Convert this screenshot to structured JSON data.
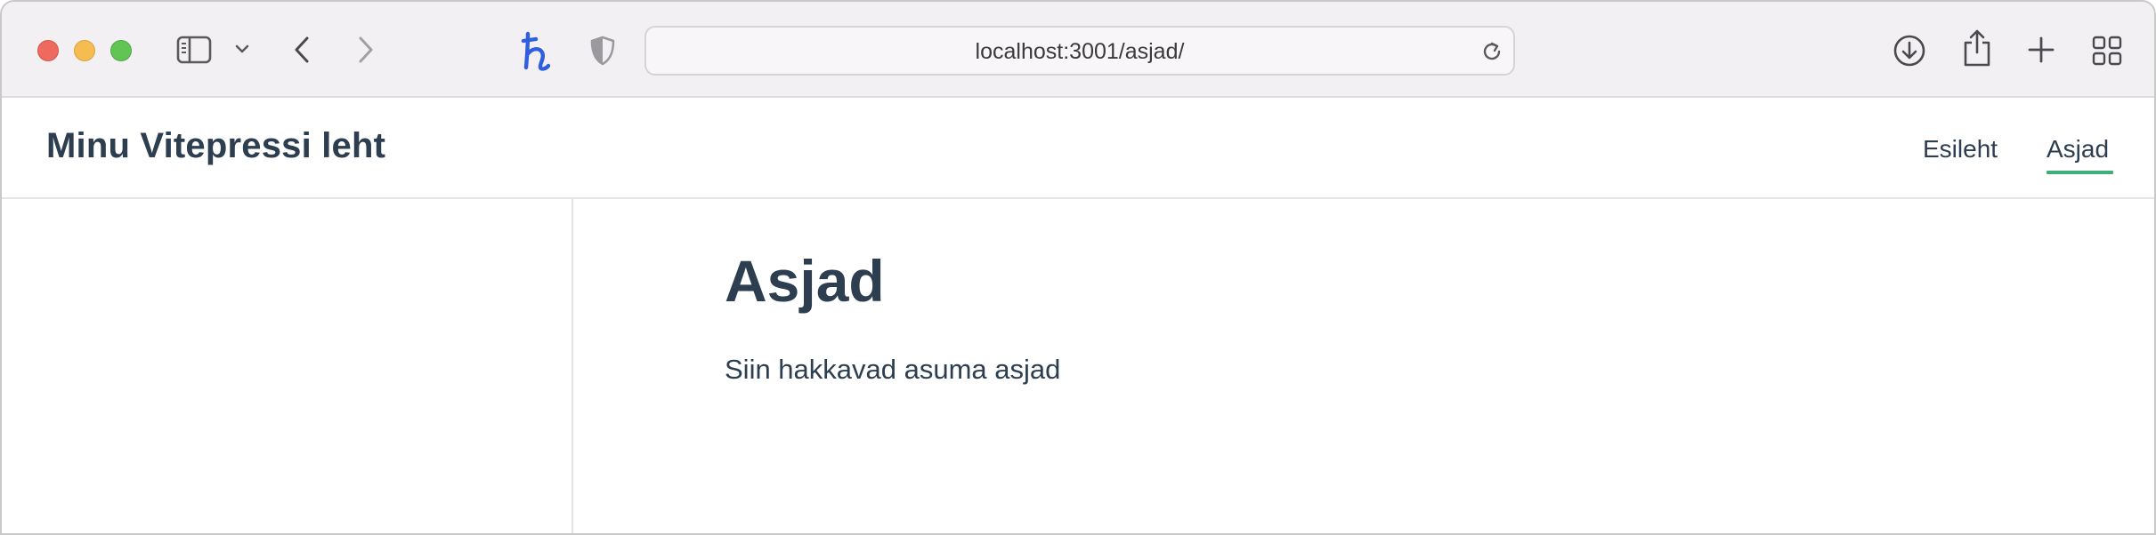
{
  "browser": {
    "url": "localhost:3001/asjad/",
    "icons": {
      "sidebar": "sidebar-icon",
      "sidebar_menu": "chevron-down-icon",
      "back": "chevron-left-icon",
      "forward": "chevron-right-icon",
      "extension": "honey-extension-icon",
      "privacy": "shield-icon",
      "reload": "reload-icon",
      "downloads": "download-icon",
      "share": "share-icon",
      "new_tab": "plus-icon",
      "tab_overview": "grid-icon"
    }
  },
  "site": {
    "title": "Minu Vitepressi leht",
    "nav": [
      {
        "label": "Esileht",
        "active": false
      },
      {
        "label": "Asjad",
        "active": true
      }
    ],
    "accent_color": "#3eaf7c"
  },
  "page": {
    "heading": "Asjad",
    "text": "Siin hakkavad asuma asjad"
  }
}
